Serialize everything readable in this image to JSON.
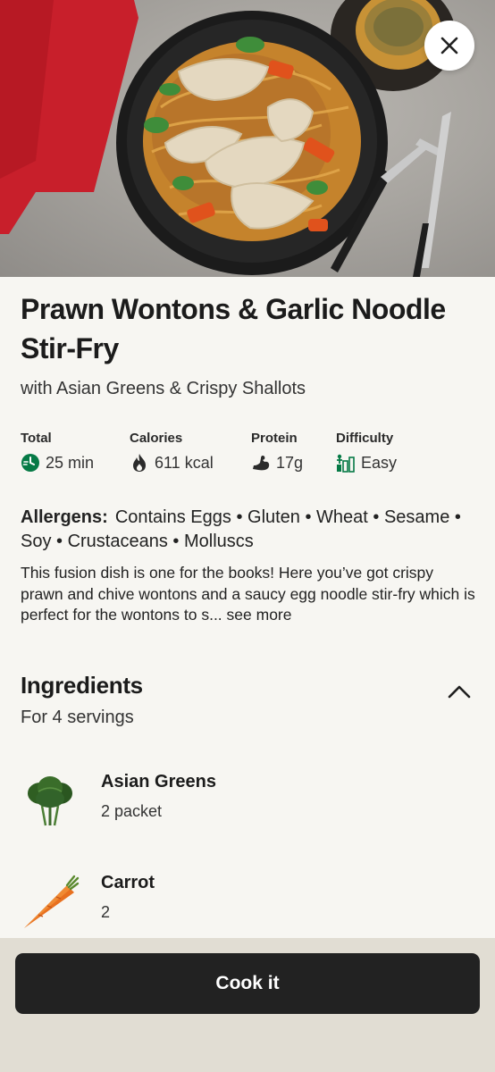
{
  "recipe": {
    "title": "Prawn Wontons & Garlic Noodle Stir-Fry",
    "subtitle": "with Asian Greens & Crispy Shallots"
  },
  "stats": [
    {
      "label": "Total",
      "value": "25 min",
      "icon": "timer-icon"
    },
    {
      "label": "Calories",
      "value": "611 kcal",
      "icon": "flame-icon"
    },
    {
      "label": "Protein",
      "value": "17g",
      "icon": "muscle-icon"
    },
    {
      "label": "Difficulty",
      "value": "Easy",
      "icon": "difficulty-bars-icon"
    }
  ],
  "allergens": {
    "label": "Allergens:",
    "text": "Contains Eggs • Gluten • Wheat • Sesame • Soy • Crustaceans • Molluscs"
  },
  "description": {
    "text": "This fusion dish is one for the books! Here you’ve got crispy prawn and chive wontons and a saucy egg noodle stir-fry which is perfect for the wontons to s...",
    "see_more": "see more"
  },
  "ingredients": {
    "title": "Ingredients",
    "servings": "For 4 servings",
    "items": [
      {
        "name": "Asian Greens",
        "quantity": "2 packet",
        "icon": "asian-greens-image"
      },
      {
        "name": "Carrot",
        "quantity": "2",
        "icon": "carrot-image"
      }
    ]
  },
  "footer": {
    "cook_label": "Cook it"
  },
  "colors": {
    "accent_green": "#067a46",
    "button_dark": "#222222",
    "footer_bg": "#e1ddd3",
    "page_bg": "#f7f6f2"
  }
}
